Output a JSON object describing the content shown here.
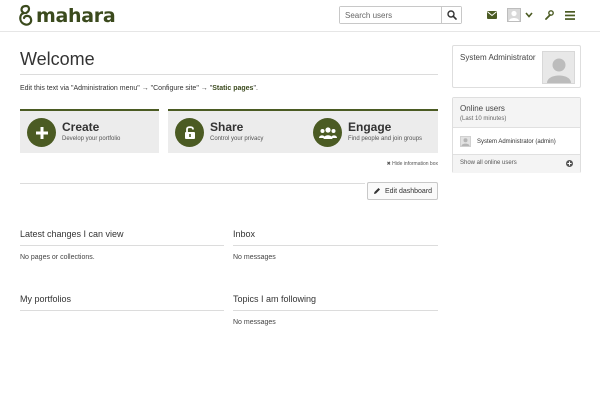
{
  "header": {
    "logo_text": "mahara",
    "search": {
      "placeholder": "Search users"
    },
    "icons": [
      "search-icon",
      "envelope-icon",
      "user-menu-icon",
      "chevron-down-icon",
      "wrench-icon",
      "hamburger-menu-icon"
    ]
  },
  "main": {
    "title": "Welcome",
    "edit_text": {
      "part1": "Edit this text via \"Administration menu\"",
      "arrow1": " → ",
      "part2": "\"Configure site\"",
      "arrow2": " → ",
      "quote_open": "\"",
      "link": "Static pages",
      "quote_close": "\"."
    },
    "cards": [
      {
        "title": "Create",
        "subtitle": "Develop your portfolio",
        "icon": "plus-icon"
      },
      {
        "title": "Share",
        "subtitle": "Control your privacy",
        "icon": "unlock-icon"
      },
      {
        "title": "Engage",
        "subtitle": "Find people and join groups",
        "icon": "users-icon"
      }
    ],
    "hide_info": "✖ Hide information box",
    "edit_dashboard": "Edit dashboard",
    "blocks": [
      {
        "title": "Latest changes I can view",
        "body": "No pages or collections."
      },
      {
        "title": "Inbox",
        "body": "No messages"
      },
      {
        "title": "My portfolios",
        "body": ""
      },
      {
        "title": "Topics I am following",
        "body": "No messages"
      }
    ]
  },
  "sidebar": {
    "profile_name": "System Administrator",
    "online": {
      "title": "Online users",
      "subtitle": "(Last 10 minutes)",
      "user": "System Administrator (admin)",
      "show_all": "Show all online users"
    }
  },
  "colors": {
    "brand": "#4b5b23",
    "brand_dark": "#3b4a1d",
    "card_bg": "#ececec"
  }
}
